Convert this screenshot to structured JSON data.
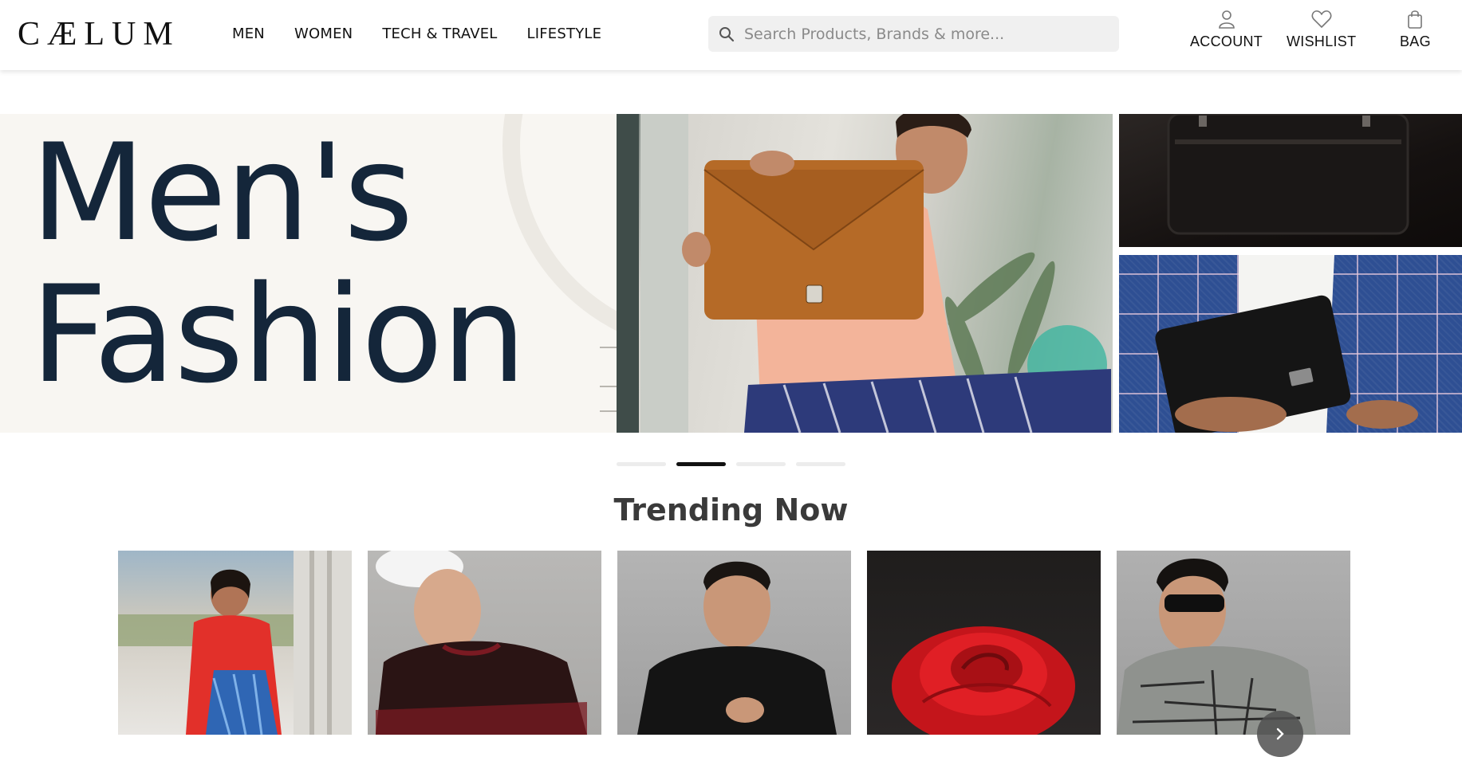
{
  "header": {
    "logo_text": "CÆLUM",
    "nav": [
      {
        "label": "MEN"
      },
      {
        "label": "WOMEN"
      },
      {
        "label": "TECH & TRAVEL"
      },
      {
        "label": "LIFESTYLE"
      }
    ],
    "search": {
      "placeholder": "Search Products, Brands & more..."
    },
    "actions": {
      "account": {
        "label": "ACCOUNT",
        "icon": "user-icon"
      },
      "wishlist": {
        "label": "WISHLIST",
        "icon": "heart-icon"
      },
      "bag": {
        "label": "BAG",
        "icon": "shopping-bag-icon"
      }
    }
  },
  "hero": {
    "title_line1": "Men's",
    "title_line2": "Fashion",
    "slides_total": 4,
    "active_slide": 2,
    "images": [
      "man-holding-tan-leather-folio-bag",
      "black-leather-laptop-bag",
      "black-leather-wallet-on-checked-blazer"
    ]
  },
  "trending": {
    "title": "Trending Now",
    "items": [
      {
        "image": "woman-in-red-and-blue-half-saree"
      },
      {
        "image": "man-in-maroon-sweatshirt-and-white-cap"
      },
      {
        "image": "man-in-black-shirt"
      },
      {
        "image": "red-rose"
      },
      {
        "image": "man-in-sunglasses-and-grey-printed-tshirt"
      }
    ],
    "next_icon": "chevron-right-icon"
  },
  "colors": {
    "hero_text": "#14263a",
    "hero_bg": "#f8f6f2",
    "search_bg": "#f0f0f0",
    "active_dot": "#111111"
  }
}
